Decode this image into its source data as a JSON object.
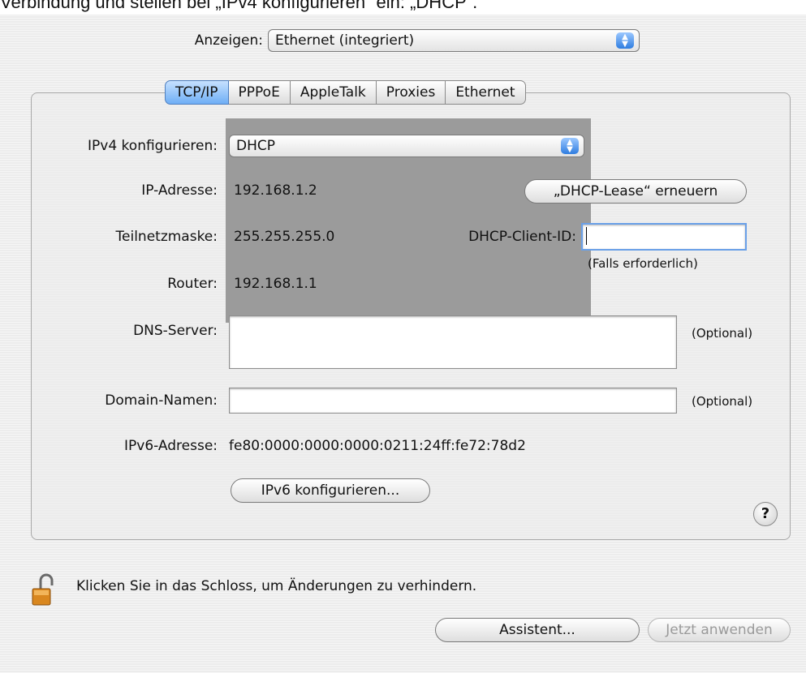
{
  "caption": "Verbindung und stellen bei „IPv4 konfigurieren“ ein: „DHCP“.",
  "show": {
    "label": "Anzeigen:",
    "value": "Ethernet (integriert)"
  },
  "tabs": [
    "TCP/IP",
    "PPPoE",
    "AppleTalk",
    "Proxies",
    "Ethernet"
  ],
  "ipv4": {
    "label": "IPv4 konfigurieren:",
    "value": "DHCP"
  },
  "ip": {
    "label": "IP-Adresse:",
    "value": "192.168.1.2"
  },
  "renew_button": "„DHCP-Lease“ erneuern",
  "subnet": {
    "label": "Teilnetzmaske:",
    "value": "255.255.255.0"
  },
  "client_id": {
    "label": "DHCP-Client-ID:",
    "value": "",
    "hint": "(Falls erforderlich)"
  },
  "router": {
    "label": "Router:",
    "value": "192.168.1.1"
  },
  "dns": {
    "label": "DNS-Server:",
    "value": "",
    "optional": "(Optional)"
  },
  "domain": {
    "label": "Domain-Namen:",
    "value": "",
    "optional": "(Optional)"
  },
  "ipv6": {
    "label": "IPv6-Adresse:",
    "value": "fe80:0000:0000:0000:0211:24ff:fe72:78d2"
  },
  "ipv6_button": "IPv6 konfigurieren...",
  "help": "?",
  "lock_text": "Klicken Sie in das Schloss, um Änderungen zu verhindern.",
  "assistant_button": "Assistent...",
  "apply_button": "Jetzt anwenden",
  "colors": {
    "highlight": "#9b9b9b",
    "active_tab": "#6eaef5",
    "focus_ring": "#6aa0e8"
  }
}
